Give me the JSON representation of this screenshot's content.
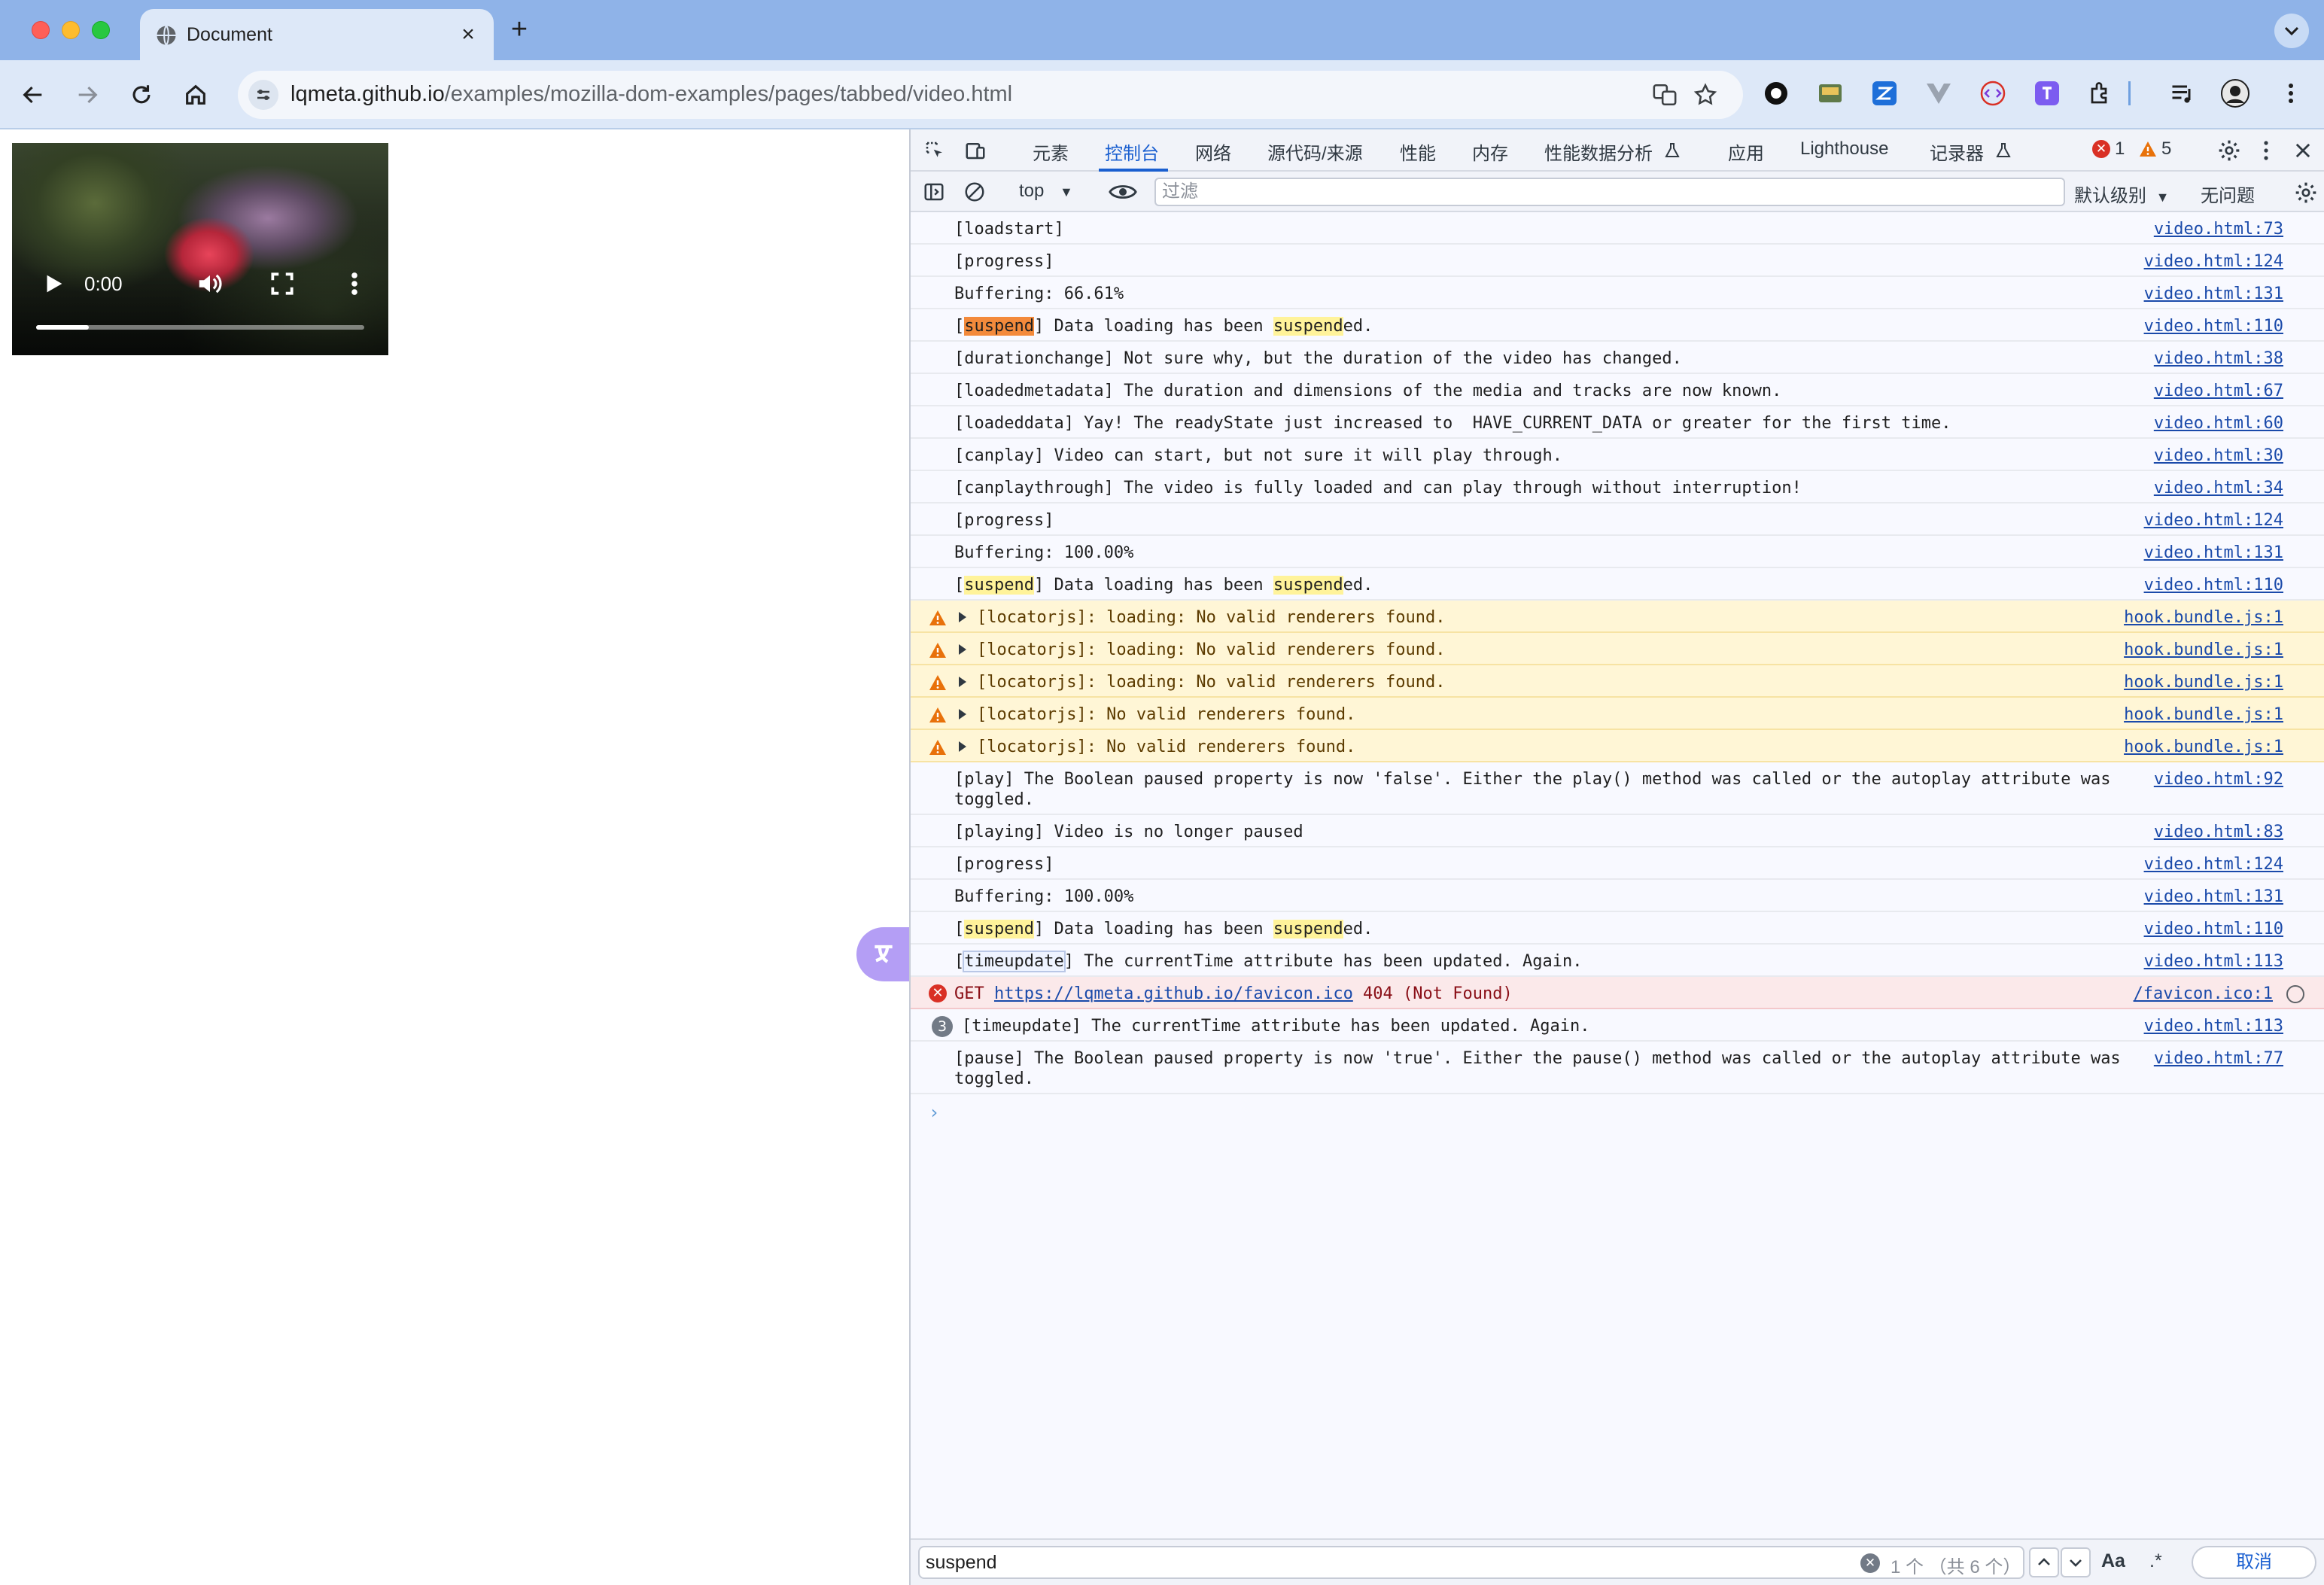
{
  "browser": {
    "tab_title": "Document",
    "close_label": "×",
    "newtab_label": "+",
    "url_host": "lqmeta.github.io",
    "url_path": "/examples/mozilla-dom-examples/pages/tabbed/video.html"
  },
  "video": {
    "time": "0:00",
    "progress_fraction": 0.16
  },
  "devtools": {
    "tabs": [
      "元素",
      "控制台",
      "网络",
      "源代码/来源",
      "性能",
      "内存",
      "性能数据分析",
      "应用",
      "Lighthouse",
      "记录器"
    ],
    "active_tab": "控制台",
    "error_count": "1",
    "warning_count": "5",
    "context": "top",
    "filter_placeholder": "过滤",
    "levels_label": "默认级别",
    "issues_label": "无问题",
    "prompt": "›"
  },
  "console_rows": [
    {
      "type": "log",
      "text": "[loadstart]",
      "source": "video.html:73"
    },
    {
      "type": "log",
      "text": "[progress]",
      "source": "video.html:124"
    },
    {
      "type": "log",
      "text": "Buffering: 66.61%",
      "source": "video.html:131"
    },
    {
      "type": "log",
      "pre1": "[",
      "hl1": "suspend",
      "mid": "] Data loading has been ",
      "hl2": "suspend",
      "post": "ed.",
      "source": "video.html:110",
      "current": true
    },
    {
      "type": "log",
      "text": "[durationchange] Not sure why, but the duration of the video has changed.",
      "source": "video.html:38"
    },
    {
      "type": "log",
      "text": "[loadedmetadata] The duration and dimensions of the media and tracks are now known.",
      "source": "video.html:67"
    },
    {
      "type": "log",
      "text": "[loadeddata] Yay! The readyState just increased to  HAVE_CURRENT_DATA or greater for the first time.",
      "source": "video.html:60"
    },
    {
      "type": "log",
      "text": "[canplay] Video can start, but not sure it will play through.",
      "source": "video.html:30"
    },
    {
      "type": "log",
      "text": "[canplaythrough] The video is fully loaded and can play through without interruption!",
      "source": "video.html:34"
    },
    {
      "type": "log",
      "text": "[progress]",
      "source": "video.html:124"
    },
    {
      "type": "log",
      "text": "Buffering: 100.00%",
      "source": "video.html:131"
    },
    {
      "type": "log",
      "pre1": "[",
      "hl1": "suspend",
      "mid": "] Data loading has been ",
      "hl2": "suspend",
      "post": "ed.",
      "source": "video.html:110"
    },
    {
      "type": "warn",
      "text": "[locatorjs]: loading: No valid renderers found.",
      "source": "hook.bundle.js:1"
    },
    {
      "type": "warn",
      "text": "[locatorjs]: loading: No valid renderers found.",
      "source": "hook.bundle.js:1"
    },
    {
      "type": "warn",
      "text": "[locatorjs]: loading: No valid renderers found.",
      "source": "hook.bundle.js:1"
    },
    {
      "type": "warn",
      "text": "[locatorjs]: No valid renderers found.",
      "source": "hook.bundle.js:1"
    },
    {
      "type": "warn",
      "text": "[locatorjs]: No valid renderers found.",
      "source": "hook.bundle.js:1"
    },
    {
      "type": "log",
      "text": "[play] The Boolean paused property is now 'false'. Either the play() method was called or the autoplay attribute was\ntoggled.",
      "source": "video.html:92"
    },
    {
      "type": "log",
      "text": "[playing] Video is no longer paused",
      "source": "video.html:83"
    },
    {
      "type": "log",
      "text": "[progress]",
      "source": "video.html:124"
    },
    {
      "type": "log",
      "text": "Buffering: 100.00%",
      "source": "video.html:131"
    },
    {
      "type": "log",
      "pre1": "[",
      "hl1": "suspend",
      "mid": "] Data loading has been ",
      "hl2": "suspend",
      "post": "ed.",
      "source": "video.html:110"
    },
    {
      "type": "log",
      "pre1": "[",
      "box": "timeupdate",
      "post": "] The currentTime attribute has been updated. Again.",
      "source": "video.html:113"
    },
    {
      "type": "error",
      "pre1": "GET ",
      "link": "https://lqmeta.github.io/favicon.ico",
      "post": " 404 (Not Found)",
      "source": "/favicon.ico:1"
    },
    {
      "type": "log",
      "count": "3",
      "text": "[timeupdate] The currentTime attribute has been updated. Again.",
      "source": "video.html:113"
    },
    {
      "type": "log",
      "text": "[pause] The Boolean paused property is now 'true'. Either the pause() method was called or the autoplay attribute was\ntoggled.",
      "source": "video.html:77"
    }
  ],
  "search": {
    "value": "suspend",
    "count": "1 个 （共 6 个）",
    "case_label": "Aa",
    "regex_label": ".*",
    "cancel_label": "取消"
  },
  "colors": {
    "accent": "#1a5fd0",
    "warn_bg": "#fff6d6",
    "error_bg": "#fbe9ea",
    "highlight": "#fff39a",
    "current_highlight": "#f38a3b"
  }
}
